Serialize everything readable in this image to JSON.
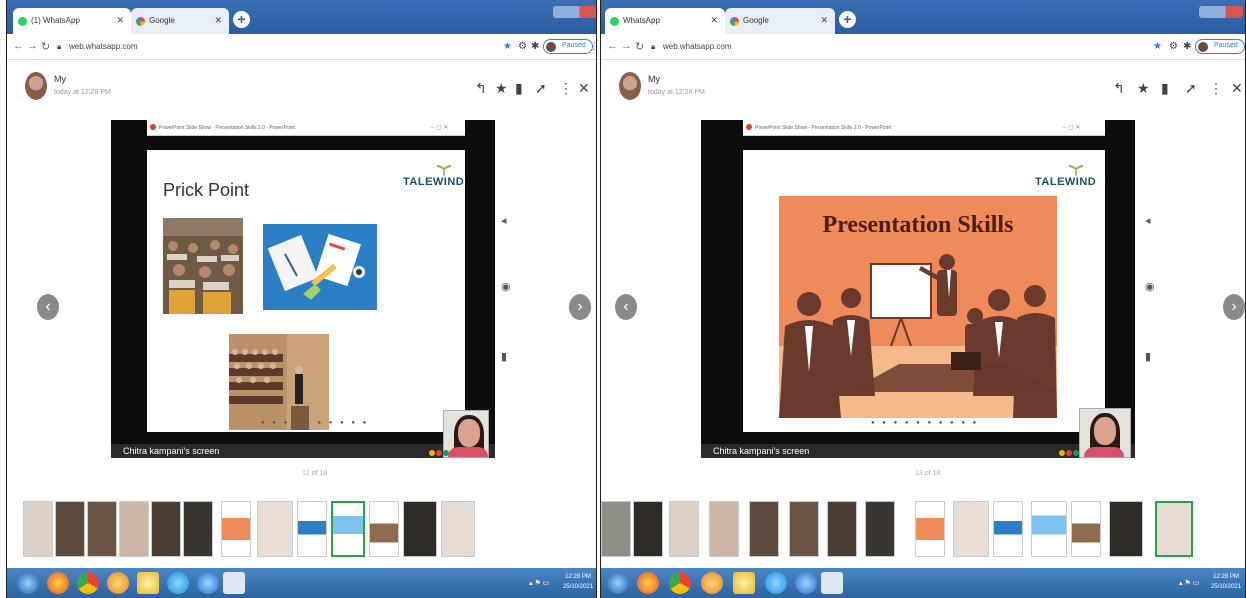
{
  "colors": {
    "accent": "#2b5d9f",
    "orange_slide": "#ef8a5a",
    "silhouette": "#6a3a2e",
    "green_frame": "#2aa04a"
  },
  "left": {
    "tabs": [
      {
        "label": "(1) WhatsApp",
        "icon": "whatsapp-icon"
      },
      {
        "label": "Google",
        "icon": "google-icon"
      }
    ],
    "url": "web.whatsapp.com",
    "paused_label": "Paused",
    "sender": "My",
    "time": "today at 12:28 PM",
    "ppt_title": "PowerPoint Slide Show - Presentation Skills 2.0 - PowerPoint",
    "brand": "TALEWIND",
    "slide_title": "Prick Point",
    "slide_dots": "● ● ● ● ● ● ● ● ● ●",
    "screen_label": "Chitra kampani's screen",
    "counter": "12 of 18",
    "clock": {
      "time": "12:28 PM",
      "date": "25/10/2021"
    }
  },
  "right": {
    "tabs": [
      {
        "label": "WhatsApp",
        "icon": "whatsapp-icon"
      },
      {
        "label": "Google",
        "icon": "google-icon"
      }
    ],
    "url": "web.whatsapp.com",
    "paused_label": "Paused",
    "sender": "My",
    "time": "today at 12:28 PM",
    "ppt_title": "PowerPoint Slide Show - Presentation Skills 2.0 - PowerPoint",
    "brand": "TALEWIND",
    "slide_title": "Presentation Skills",
    "slide_dots": "● ● ● ● ● ● ● ● ● ●",
    "screen_label": "Chitra kampani's screen",
    "counter": "13 of 18",
    "clock": {
      "time": "12:28 PM",
      "date": "25/10/2021"
    }
  }
}
